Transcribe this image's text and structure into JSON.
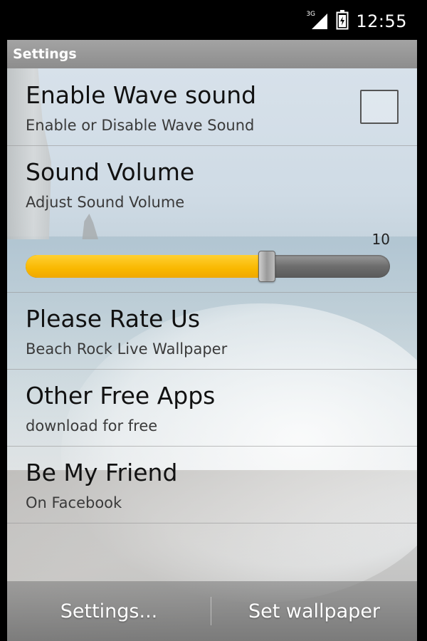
{
  "status_bar": {
    "network_label": "3G",
    "time": "12:55"
  },
  "title_bar": {
    "title": "Settings"
  },
  "preferences": [
    {
      "title": "Enable Wave sound",
      "summary": "Enable or Disable Wave Sound",
      "checked": false
    },
    {
      "title": "Sound Volume",
      "summary": "Adjust Sound Volume",
      "slider_value": "10",
      "slider_fraction": 0.66
    },
    {
      "title": "Please Rate Us",
      "summary": "Beach Rock Live Wallpaper"
    },
    {
      "title": "Other Free Apps",
      "summary": "download for free"
    },
    {
      "title": "Be My Friend",
      "summary": "On Facebook"
    }
  ],
  "bottom_bar": {
    "settings_label": "Settings...",
    "set_wallpaper_label": "Set wallpaper"
  },
  "colors": {
    "slider_fill": "#f9b800",
    "title_bar": "#969696"
  },
  "icons": [
    "signal-icon",
    "battery-icon"
  ]
}
